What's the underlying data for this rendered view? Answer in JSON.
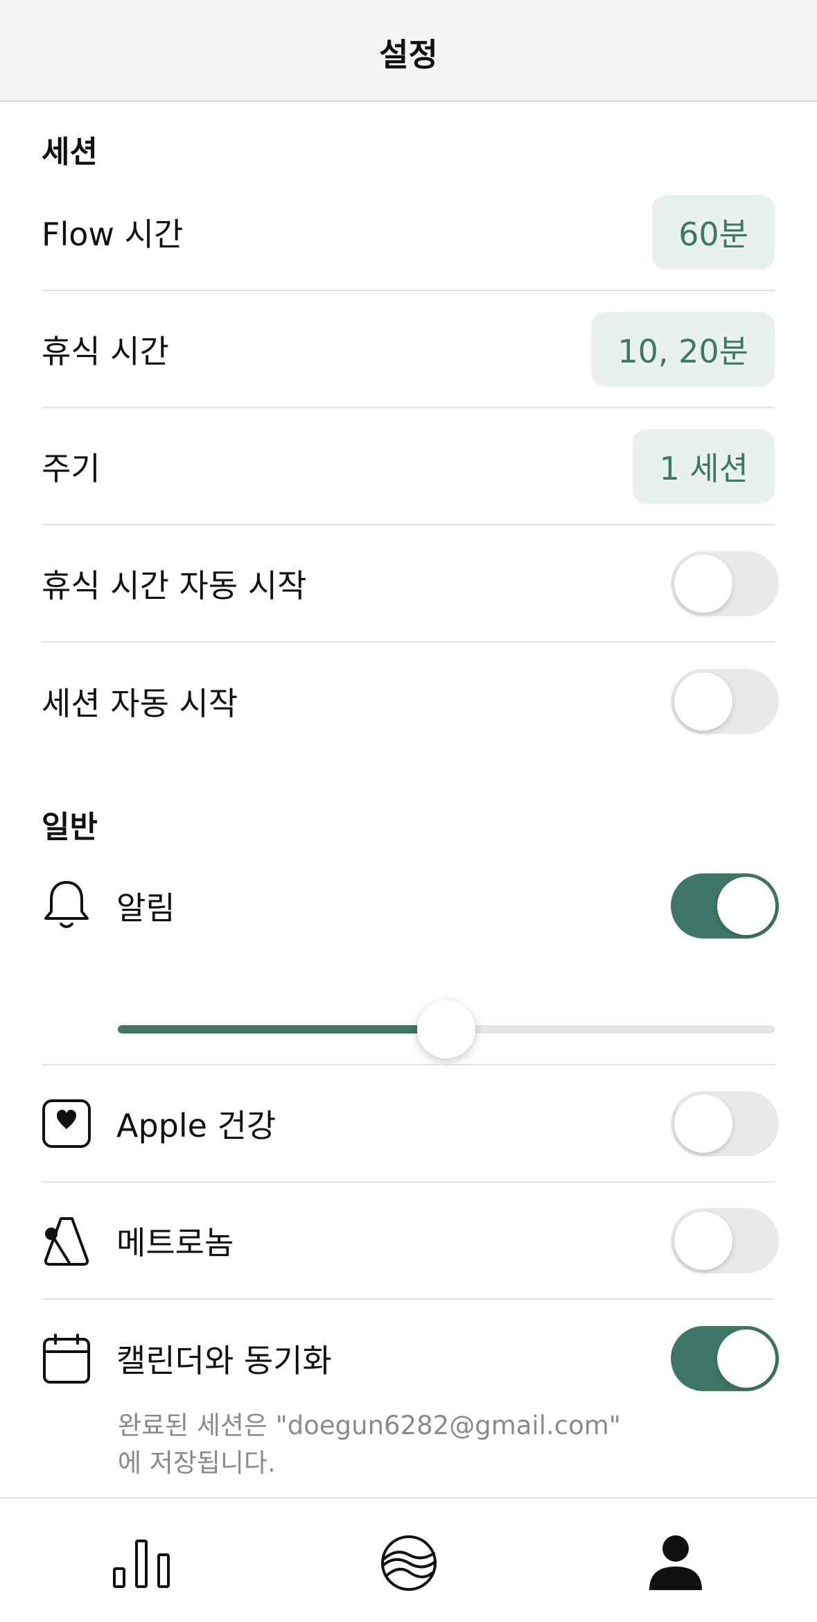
{
  "header": {
    "title": "설정"
  },
  "session": {
    "title": "세션",
    "flow_time": {
      "label": "Flow 시간",
      "value": "60분"
    },
    "break_time": {
      "label": "휴식 시간",
      "value": "10, 20분"
    },
    "cycle": {
      "label": "주기",
      "value": "1 세션"
    },
    "auto_break": {
      "label": "휴식 시간 자동 시작",
      "enabled": false
    },
    "auto_session": {
      "label": "세션 자동 시작",
      "enabled": false
    }
  },
  "general": {
    "title": "일반",
    "alarm": {
      "label": "알림",
      "icon": "bell-icon",
      "enabled": true,
      "volume": 0.5
    },
    "apple_health": {
      "label": "Apple 건강",
      "icon": "health-heart-icon",
      "enabled": false
    },
    "metronome": {
      "label": "메트로놈",
      "icon": "metronome-icon",
      "enabled": false
    },
    "calendar_sync": {
      "label": "캘린더와 동기화",
      "icon": "calendar-icon",
      "enabled": true,
      "note": "완료된 세션은 \"doegun6282@gmail.com\"\n에 저장됩니다."
    }
  },
  "tabbar": {
    "tabs": [
      {
        "name": "stats",
        "icon": "bar-chart-icon"
      },
      {
        "name": "flow",
        "icon": "flow-wave-icon"
      },
      {
        "name": "profile",
        "icon": "person-icon",
        "active": true
      }
    ]
  },
  "colors": {
    "accent": "#3e7767",
    "pill_bg": "#e9f1ee",
    "toggle_off": "#e9e9e9"
  }
}
